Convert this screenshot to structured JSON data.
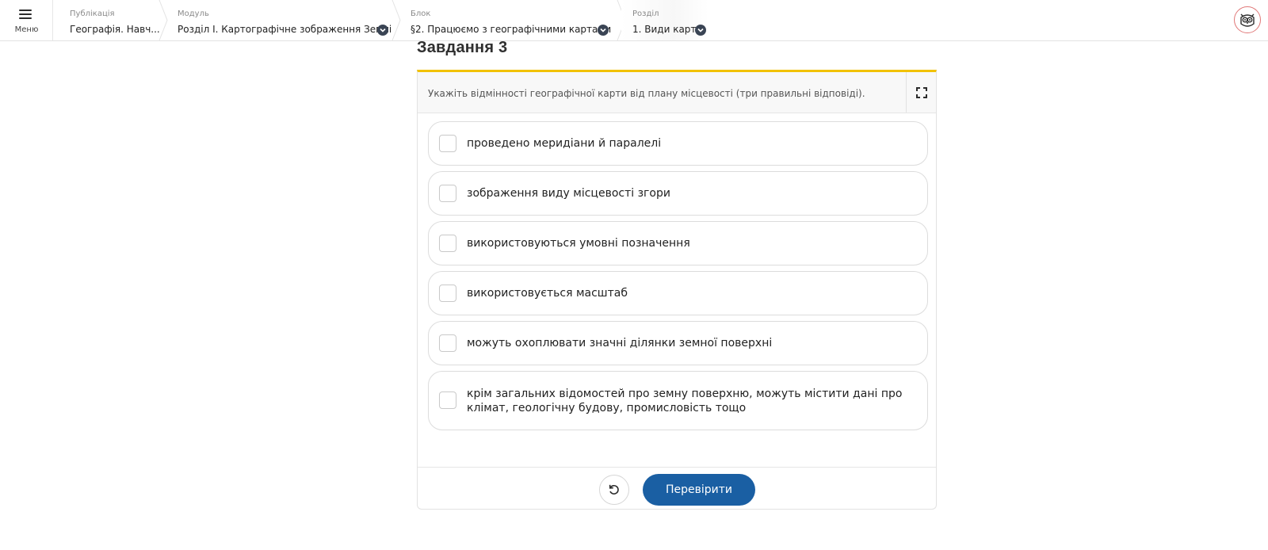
{
  "header": {
    "menu_label": "Меню",
    "breadcrumbs": [
      {
        "caption": "Публікація",
        "value": "Географія. Навч..."
      },
      {
        "caption": "Модуль",
        "value": "Розділ I. Картографічне зображення Землі"
      },
      {
        "caption": "Блок",
        "value": "§2. Працюємо з географічними картами"
      },
      {
        "caption": "Розділ",
        "value": "1. Види карт"
      }
    ]
  },
  "task": {
    "title": "Завдання 3",
    "question": "Укажіть відмінності географічної карти від плану місцевості (три правильні відповіді).",
    "options": [
      {
        "line1": "проведено меридіани й паралелі",
        "line2": "",
        "checked": false
      },
      {
        "line1": "зображення виду місцевості згори",
        "line2": "",
        "checked": false
      },
      {
        "line1": "використовуються умовні позначення",
        "line2": "",
        "checked": false
      },
      {
        "line1": "використовується масштаб",
        "line2": "",
        "checked": false
      },
      {
        "line1": "можуть охоплювати значні ділянки земної поверхні",
        "line2": "",
        "checked": false
      },
      {
        "line1": "крім загальних відомостей про земну поверхню, можуть містити дані про",
        "line2": "клімат, геологічну будову, промисловість тощо",
        "checked": false
      }
    ],
    "check_button": "Перевірити"
  },
  "colors": {
    "accent_yellow": "#f2c200",
    "button_blue": "#1a5fa3",
    "chevron_dark": "#3a4454"
  },
  "icons": {
    "menu": "hamburger-icon",
    "chevron": "chevron-down-icon",
    "avatar": "owl-logo-icon",
    "fullscreen": "fullscreen-icon",
    "reset": "reset-icon"
  }
}
